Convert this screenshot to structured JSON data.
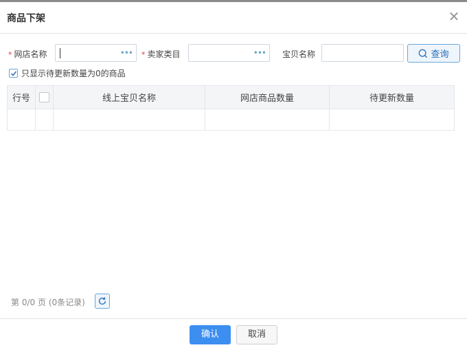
{
  "dialog": {
    "title": "商品下架",
    "close_glyph": "✕"
  },
  "form": {
    "shop_label": "网店名称",
    "seller_category_label": "卖家类目",
    "item_name_label": "宝贝名称",
    "required_mark": "*",
    "shop_value": "",
    "seller_category_value": "",
    "item_name_value": "",
    "lookup_glyph": "•••",
    "search_label": "查询"
  },
  "filter": {
    "checked": true,
    "label": "只显示待更新数量为0的商品"
  },
  "table": {
    "headers": [
      "行号",
      "",
      "线上宝贝名称",
      "网店商品数量",
      "待更新数量"
    ],
    "rows": []
  },
  "pager": {
    "text": "第 0/0 页 (0条记录)"
  },
  "footer": {
    "confirm_label": "确认",
    "cancel_label": "取消"
  },
  "colors": {
    "primary": "#3c8ef0",
    "required": "#e4393c",
    "accent_border": "#6aa6d8"
  }
}
